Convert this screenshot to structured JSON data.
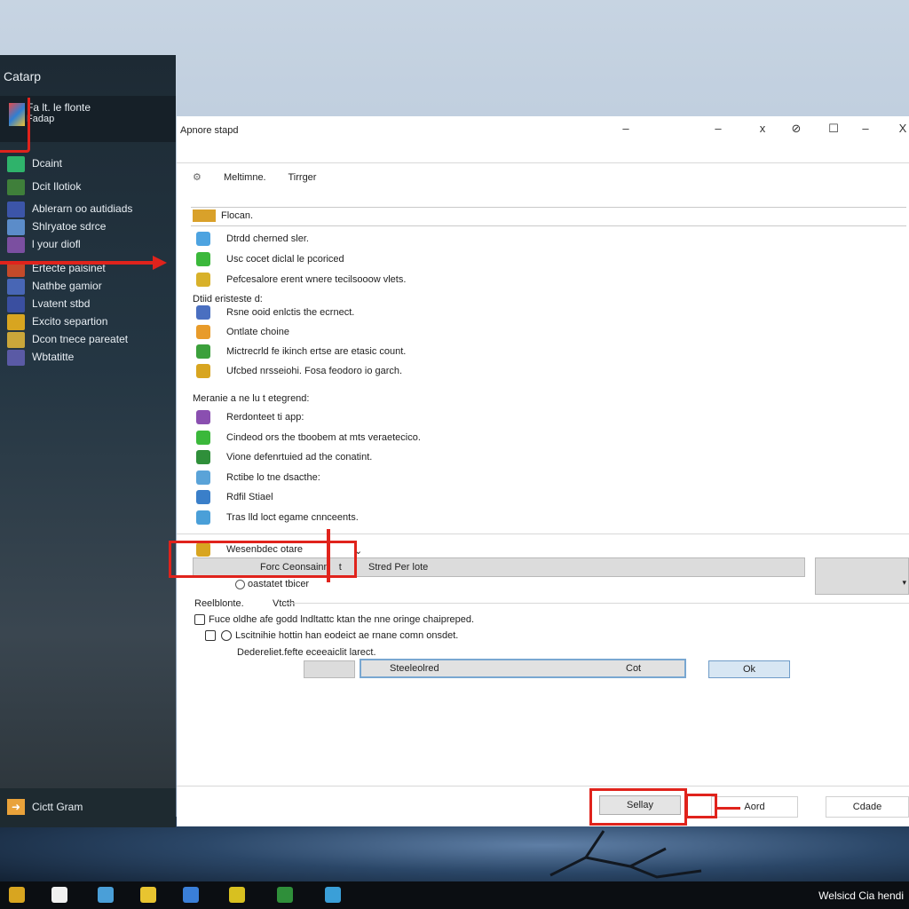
{
  "start_menu": {
    "title": "Catarp",
    "pinned": {
      "line1": "Fa lt. le flonte",
      "line2": "Fadap"
    },
    "items": [
      {
        "label": "Dcaint",
        "color": "#2fb36b"
      },
      {
        "label": "Dcit Ilotiok",
        "color": "#3f7f3a"
      },
      {
        "label": "Ablerarn oo autidiads",
        "color": "#3c55a8"
      },
      {
        "label": "Shlryatoe sdrce",
        "color": "#5b8cc9"
      },
      {
        "label": "l your diofl",
        "color": "#7b4fa0"
      },
      {
        "label": "Ertecte paisinet",
        "color": "#c44a2a"
      },
      {
        "label": "Nathbe gamior",
        "color": "#4866b5"
      },
      {
        "label": "Lvatent stbd",
        "color": "#3a4fa0"
      },
      {
        "label": "Excito separtion",
        "color": "#d8a520"
      },
      {
        "label": "Dcon tnece pareatet",
        "color": "#c9a63a"
      },
      {
        "label": "Wbtatitte",
        "color": "#5a5aa5"
      }
    ],
    "bottom": {
      "label": "Cictt Gram",
      "icon": "arrow-icon"
    }
  },
  "dialog": {
    "title": "Apnore stapd",
    "controls": [
      "–",
      "x",
      "⊘",
      "☐",
      "–",
      "X"
    ],
    "tabs": [
      "Meltimne.",
      "Tirrger"
    ],
    "header_row": "Flocan.",
    "rows_group1": [
      {
        "label": "Dtrdd cherned sler.",
        "color": "#4da3e0"
      },
      {
        "label": "Usc cocet diclal le pcoriced",
        "color": "#3bb83b"
      },
      {
        "label": "Pefcesalore erent wnere tecilsooow vlets.",
        "color": "#d8b12a"
      }
    ],
    "group2_label": "Dtiid eristeste d:",
    "rows_group2": [
      {
        "label": "Rsne ooid enlctis the ecrnect.",
        "color": "#4a6fc0"
      },
      {
        "label": "Ontlate choine",
        "color": "#e89b2a"
      },
      {
        "label": "Mictrecrld fe ikinch ertse are etasic count.",
        "color": "#3ba03b"
      },
      {
        "label": "Ufcbed nrsseiohi. Fosa feodoro io garch.",
        "color": "#d8a520"
      }
    ],
    "group3_label": "Meranie a ne lu t etegrend:",
    "rows_group3": [
      {
        "label": "Rerdonteet ti app:",
        "color": "#8a4fb0"
      },
      {
        "label": "Cindeod ors the tboobem at mts veraetecico.",
        "color": "#3bb83b"
      },
      {
        "label": "Vione defenrtuied ad the conatint.",
        "color": "#2f8f3a"
      },
      {
        "label": "Rctibe lo tne dsacthe:",
        "color": "#5aa3d8"
      },
      {
        "label": "Rdfil Stiael",
        "color": "#3a7fc9"
      },
      {
        "label": "Tras lld loct egame cnnceents.",
        "color": "#4a9fd8"
      }
    ],
    "selected_row": {
      "label": "Wesenbdec otare",
      "combo1": "Forc Ceonsainn",
      "combo1_suffix": "t",
      "combo2": "Stred Per lote"
    },
    "checkbox_label": "oastatet tbicer",
    "section_label": "Reelblonte.",
    "section_label2": "Vtcth",
    "options": [
      "Fuce oldhe afe godd lndltattc ktan the nne oringe chaipreped.",
      "Lscitnihie hottin han eodeict ae rnane comn onsdet."
    ],
    "option_sub": "Dedereliet.fefte eceeaiclit larect.",
    "inputs": {
      "field1": "",
      "field2": "Steeleolred",
      "field2_end": "Cot"
    },
    "ok_label": "Ok",
    "footer": {
      "primary": "Sellay",
      "secondary": "Aord",
      "cancel": "Cdade"
    }
  },
  "taskbar": {
    "icons": [
      {
        "name": "shield-icon",
        "color": "#d8a520"
      },
      {
        "name": "document-icon",
        "color": "#f0f0f0"
      },
      {
        "name": "puzzle-icon",
        "color": "#4a9fd8"
      },
      {
        "name": "note-icon",
        "color": "#e8c430"
      },
      {
        "name": "globe-icon",
        "color": "#3a7fd8"
      },
      {
        "name": "folder-icon",
        "color": "#d8c020"
      },
      {
        "name": "terminal-icon",
        "color": "#2f8f3a"
      },
      {
        "name": "browser-icon",
        "color": "#3a9fd8"
      }
    ],
    "clock": "Welsicd Cia hendi"
  },
  "colors": {
    "annotation": "#e0231c",
    "accent": "#6f9cc8"
  }
}
